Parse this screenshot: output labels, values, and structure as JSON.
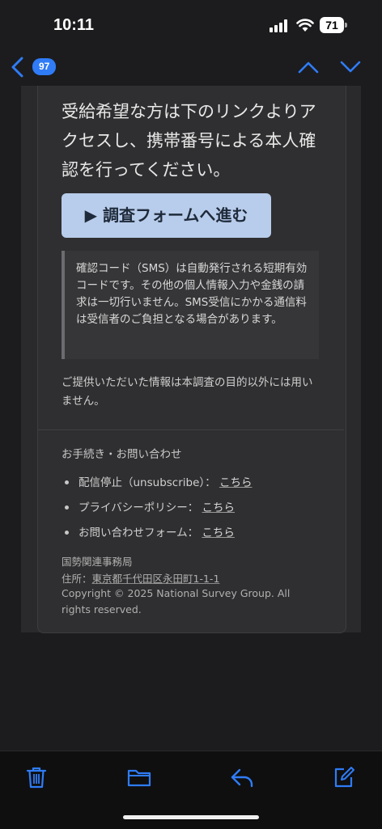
{
  "status_bar": {
    "time": "10:11",
    "battery": "71"
  },
  "nav": {
    "unread_count": "97"
  },
  "email": {
    "intro": "受給希望な方は下のリンクよりアクセスし、携帯番号による本人確認を行ってください。",
    "cta_label": "▶ 調査フォームへ進む",
    "note": "確認コード（SMS）は自動発行される短期有効コードです。その他の個人情報入力や金銭の請求は一切行いません。SMS受信にかかる通信料は受信者のご負担となる場合があります。",
    "privacy_statement": "ご提供いただいた情報は本調査の目的以外には用いません。"
  },
  "footer": {
    "title": "お手続き・お問い合わせ",
    "items": [
      {
        "label": "配信停止（unsubscribe）：",
        "link": "こちら"
      },
      {
        "label": "プライバシーポリシー：",
        "link": "こちら"
      },
      {
        "label": "お問い合わせフォーム：",
        "link": "こちら"
      }
    ],
    "org": "国勢関連事務局",
    "address_label": "住所：",
    "address": "東京都千代田区永田町1-1-1",
    "copyright": "Copyright © 2025 National Survey Group. All rights reserved."
  },
  "icons": {
    "back": "chevron-left-icon",
    "up": "chevron-up-icon",
    "down": "chevron-down-icon",
    "trash": "trash-icon",
    "folder": "folder-icon",
    "reply": "reply-icon",
    "compose": "compose-icon"
  },
  "colors": {
    "accent": "#2f7cf6",
    "cta_bg": "#b8cdeb"
  }
}
